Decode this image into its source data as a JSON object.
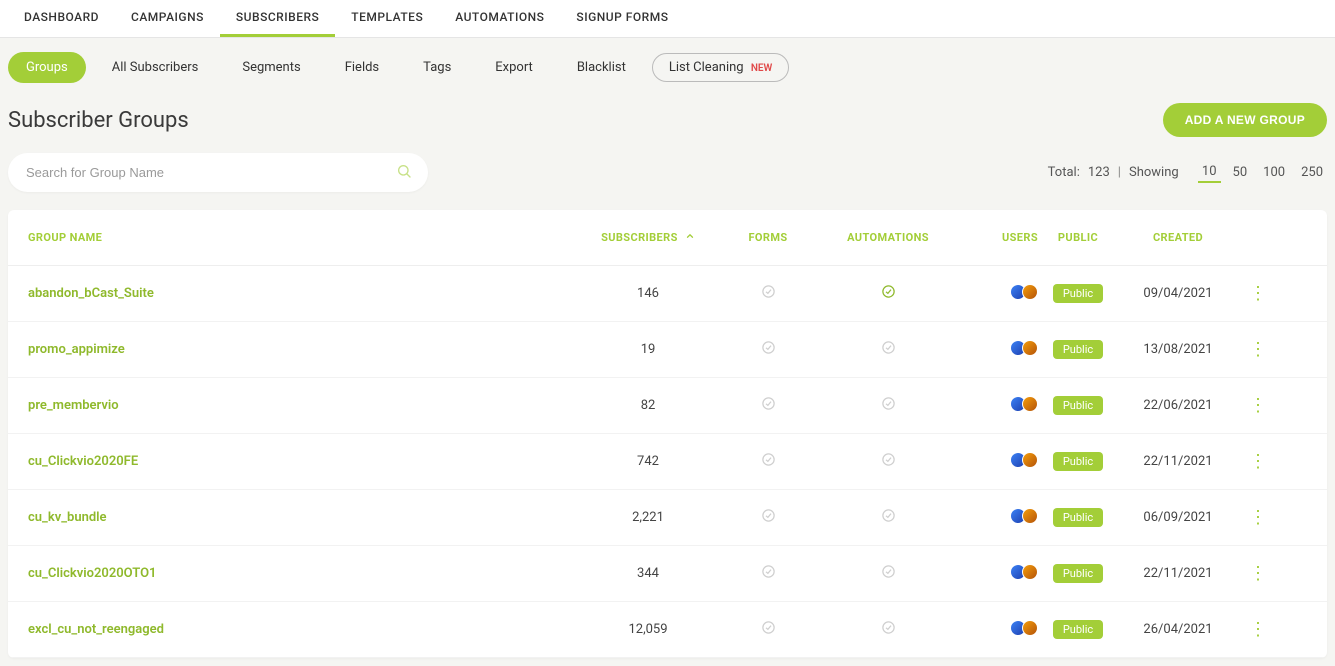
{
  "top_nav": {
    "items": [
      {
        "label": "DASHBOARD"
      },
      {
        "label": "CAMPAIGNS"
      },
      {
        "label": "SUBSCRIBERS"
      },
      {
        "label": "TEMPLATES"
      },
      {
        "label": "AUTOMATIONS"
      },
      {
        "label": "SIGNUP FORMS"
      }
    ],
    "active_index": 2
  },
  "sub_nav": {
    "items": [
      {
        "label": "Groups"
      },
      {
        "label": "All Subscribers"
      },
      {
        "label": "Segments"
      },
      {
        "label": "Fields"
      },
      {
        "label": "Tags"
      },
      {
        "label": "Export"
      },
      {
        "label": "Blacklist"
      },
      {
        "label": "List Cleaning",
        "badge": "NEW"
      }
    ],
    "active_index": 0
  },
  "page": {
    "title": "Subscriber Groups",
    "add_button": "ADD A NEW GROUP"
  },
  "search": {
    "placeholder": "Search for Group Name",
    "value": ""
  },
  "paging": {
    "total_label": "Total:",
    "total_value": "123",
    "showing_label": "Showing",
    "sizes": [
      "10",
      "50",
      "100",
      "250"
    ],
    "active_size_index": 0
  },
  "table": {
    "headers": {
      "name": "GROUP NAME",
      "subscribers": "SUBSCRIBERS",
      "forms": "FORMS",
      "automations": "AUTOMATIONS",
      "users": "USERS",
      "public": "PUBLIC",
      "created": "CREATED"
    },
    "public_badge_label": "Public",
    "rows": [
      {
        "name": "abandon_bCast_Suite",
        "subscribers": "146",
        "forms": "none",
        "automations": "active",
        "created": "09/04/2021"
      },
      {
        "name": "promo_appimize",
        "subscribers": "19",
        "forms": "none",
        "automations": "none",
        "created": "13/08/2021"
      },
      {
        "name": "pre_membervio",
        "subscribers": "82",
        "forms": "none",
        "automations": "none",
        "created": "22/06/2021"
      },
      {
        "name": "cu_Clickvio2020FE",
        "subscribers": "742",
        "forms": "none",
        "automations": "none",
        "created": "22/11/2021"
      },
      {
        "name": "cu_kv_bundle",
        "subscribers": "2,221",
        "forms": "none",
        "automations": "none",
        "created": "06/09/2021"
      },
      {
        "name": "cu_Clickvio2020OTO1",
        "subscribers": "344",
        "forms": "none",
        "automations": "none",
        "created": "22/11/2021"
      },
      {
        "name": "excl_cu_not_reengaged",
        "subscribers": "12,059",
        "forms": "none",
        "automations": "none",
        "created": "26/04/2021"
      }
    ]
  },
  "colors": {
    "accent": "#a3ce38",
    "danger": "#e04848"
  }
}
